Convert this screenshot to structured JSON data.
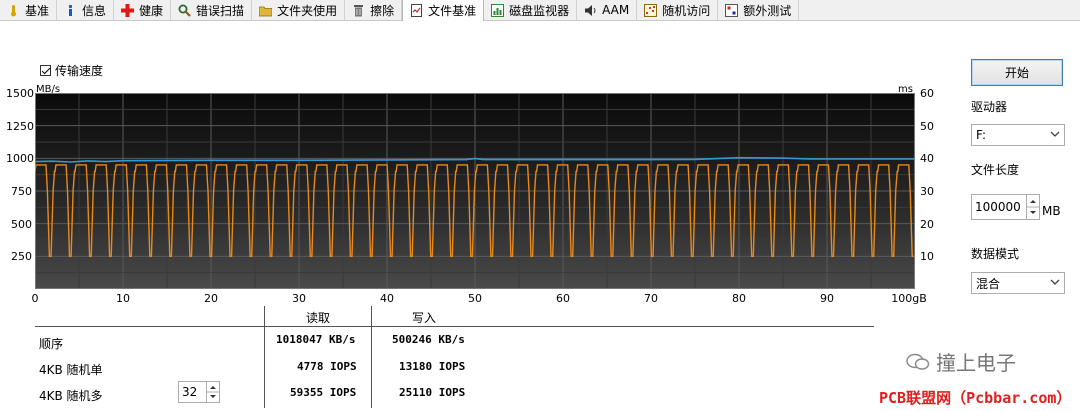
{
  "tabs": [
    {
      "label": "基准",
      "icon": "thermometer-icon"
    },
    {
      "label": "信息",
      "icon": "info-icon"
    },
    {
      "label": "健康",
      "icon": "health-cross-icon"
    },
    {
      "label": "错误扫描",
      "icon": "magnifier-icon"
    },
    {
      "label": "文件夹使用",
      "icon": "folder-icon"
    },
    {
      "label": "擦除",
      "icon": "trash-icon"
    },
    {
      "label": "文件基准",
      "icon": "file-benchmark-icon",
      "active": true
    },
    {
      "label": "磁盘监视器",
      "icon": "monitor-chart-icon"
    },
    {
      "label": "AAM",
      "icon": "speaker-icon"
    },
    {
      "label": "随机访问",
      "icon": "random-access-icon"
    },
    {
      "label": "额外测试",
      "icon": "extra-tests-icon"
    }
  ],
  "options": {
    "transfer_speed_label": "传输速度",
    "transfer_speed_checked": true
  },
  "chart": {
    "left_unit": "MB/s",
    "right_unit": "ms"
  },
  "chart_data": {
    "type": "line",
    "xlabel": "",
    "ylabel": "MB/s",
    "y2label": "ms",
    "x_unit_suffix": "gB",
    "xlim": [
      0,
      100
    ],
    "ylim": [
      0,
      1500
    ],
    "y2lim": [
      0,
      60
    ],
    "x_ticks": [
      "0",
      "10",
      "20",
      "30",
      "40",
      "50",
      "60",
      "70",
      "80",
      "90",
      "100gB"
    ],
    "y_ticks": [
      "1500",
      "1250",
      "1000",
      "750",
      "500",
      "250"
    ],
    "y2_ticks": [
      "60",
      "50",
      "40",
      "30",
      "20",
      "10"
    ],
    "grid": true,
    "series": [
      {
        "name": "读取",
        "color": "#2f9ad6",
        "axis": "left",
        "points": [
          [
            0,
            975
          ],
          [
            2,
            978
          ],
          [
            4,
            972
          ],
          [
            6,
            980
          ],
          [
            8,
            975
          ],
          [
            10,
            982
          ],
          [
            20,
            985
          ],
          [
            30,
            985
          ],
          [
            40,
            988
          ],
          [
            49,
            990
          ],
          [
            50,
            998
          ],
          [
            51,
            990
          ],
          [
            60,
            990
          ],
          [
            70,
            990
          ],
          [
            75,
            992
          ],
          [
            80,
            1005
          ],
          [
            85,
            1002
          ],
          [
            88,
            995
          ],
          [
            90,
            995
          ],
          [
            100,
            995
          ]
        ]
      },
      {
        "name": "写入",
        "color": "#e8891c",
        "axis": "right",
        "pattern": "oscillating",
        "period_gB": 2.28,
        "high_ms": 38,
        "low_ms": 10,
        "mid_ms": 30
      }
    ]
  },
  "results": {
    "col_read": "读取",
    "col_write": "写入",
    "rows": [
      {
        "label": "顺序",
        "read": "1018047 KB/s",
        "write": "500246 KB/s"
      },
      {
        "label": "4KB 随机单",
        "read": "4778 IOPS",
        "write": "13180 IOPS"
      },
      {
        "label": "4KB 随机多",
        "read": "59355 IOPS",
        "write": "25110 IOPS"
      }
    ],
    "queue_depth": "32"
  },
  "panel": {
    "start_label": "开始",
    "drive_label": "驱动器",
    "drive_value": "F:",
    "file_length_label": "文件长度",
    "file_length_value": "100000",
    "file_length_unit": "MB",
    "data_mode_label": "数据模式",
    "data_mode_value": "混合"
  },
  "watermark": {
    "channel": "撞上电子",
    "site": "PCB联盟网（Pcbbar.com）"
  }
}
